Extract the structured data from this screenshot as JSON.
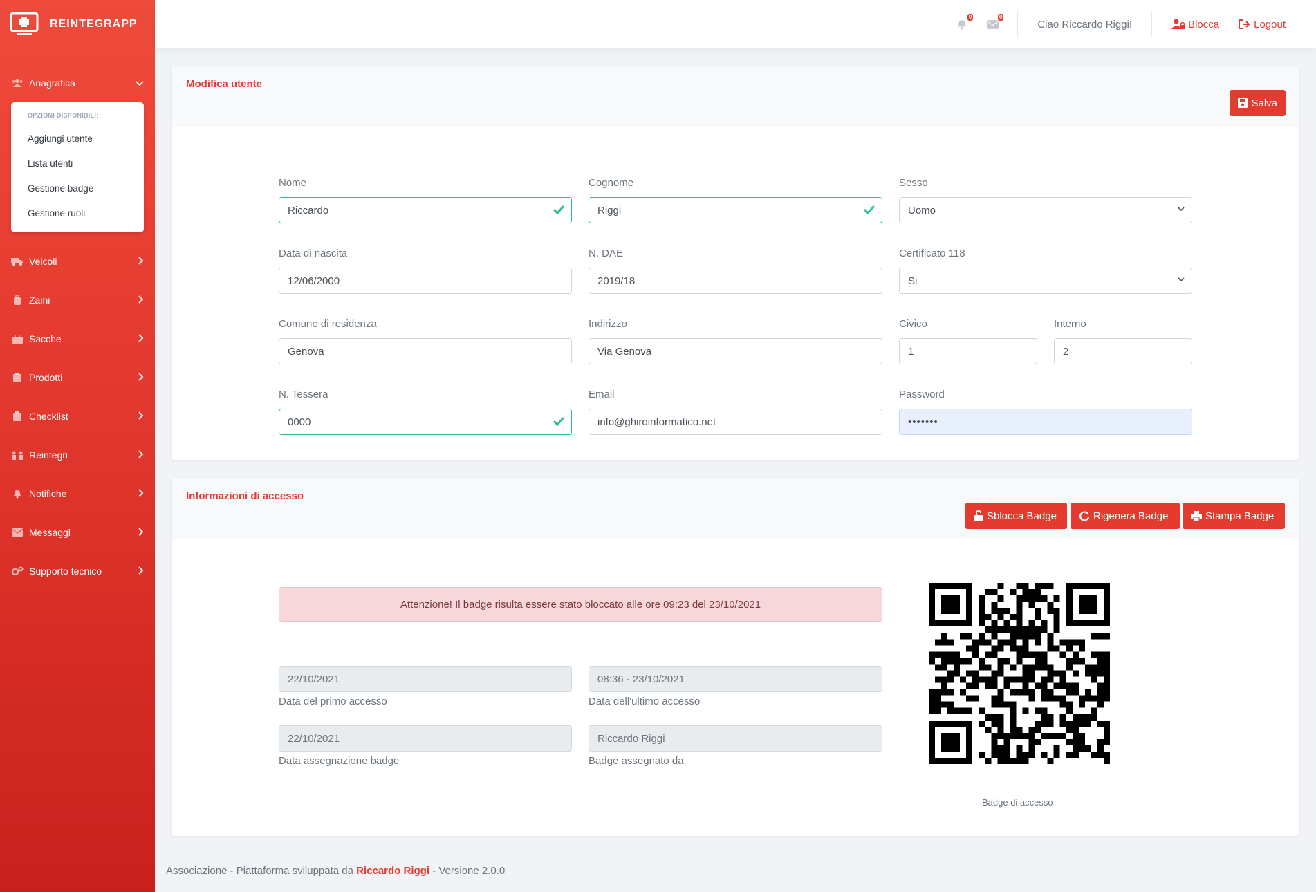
{
  "brand": {
    "name": "REINTEGRAPP"
  },
  "sidebar": {
    "anagrafica": {
      "label": "Anagrafica"
    },
    "submenu": {
      "heading": "OPZIONI DISPONIBILI:",
      "items": [
        "Aggiungi utente",
        "Lista utenti",
        "Gestione badge",
        "Gestione ruoli"
      ]
    },
    "items": [
      {
        "label": "Veicoli",
        "icon": "truck-icon"
      },
      {
        "label": "Zaini",
        "icon": "backpack-icon"
      },
      {
        "label": "Sacche",
        "icon": "briefcase-icon"
      },
      {
        "label": "Prodotti",
        "icon": "clipboard-icon"
      },
      {
        "label": "Checklist",
        "icon": "checklist-icon"
      },
      {
        "label": "Reintegri",
        "icon": "people-icon"
      },
      {
        "label": "Notifiche",
        "icon": "bell-icon"
      },
      {
        "label": "Messaggi",
        "icon": "envelope-icon"
      },
      {
        "label": "Supporto tecnico",
        "icon": "cogs-icon"
      }
    ]
  },
  "topbar": {
    "notifications_count": "0",
    "messages_count": "0",
    "greeting": "Ciao Riccardo Riggi!",
    "lock_label": "Blocca",
    "logout_label": "Logout"
  },
  "edit_card": {
    "title": "Modifica utente",
    "save_label": "Salva",
    "fields": {
      "nome": {
        "label": "Nome",
        "value": "Riccardo"
      },
      "cognome": {
        "label": "Cognome",
        "value": "Riggi"
      },
      "sesso": {
        "label": "Sesso",
        "value": "Uomo"
      },
      "data_nascita": {
        "label": "Data di nascita",
        "value": "12/06/2000"
      },
      "n_dae": {
        "label": "N. DAE",
        "value": "2019/18"
      },
      "certificato": {
        "label": "Certificato 118",
        "value": "Si"
      },
      "comune": {
        "label": "Comune di residenza",
        "value": "Genova"
      },
      "indirizzo": {
        "label": "Indirizzo",
        "value": "Via Genova"
      },
      "civico": {
        "label": "Civico",
        "value": "1"
      },
      "interno": {
        "label": "Interno",
        "value": "2"
      },
      "tessera": {
        "label": "N. Tessera",
        "value": "0000"
      },
      "email": {
        "label": "Email",
        "value": "info@ghiroinformatico.net"
      },
      "password": {
        "label": "Password",
        "value": "•••••••"
      }
    }
  },
  "access_card": {
    "title": "Informazioni di accesso",
    "unlock_label": "Sblocca Badge",
    "regen_label": "Rigenera Badge",
    "print_label": "Stampa Badge",
    "alert": "Attenzione! Il badge risulta essere stato bloccato alle ore 09:23 del 23/10/2021",
    "first_access": {
      "value": "22/10/2021",
      "label": "Data del primo accesso"
    },
    "last_access": {
      "value": "08:36 - 23/10/2021",
      "label": "Data dell'ultimo accesso"
    },
    "badge_assigned_date": {
      "value": "22/10/2021",
      "label": "Data assegnazione badge"
    },
    "badge_assigned_by": {
      "value": "Riccardo Riggi",
      "label": "Badge assegnato da"
    },
    "qr_caption": "Badge di accesso"
  },
  "footer": {
    "prefix": "Associazione - Piattaforma sviluppata da",
    "author": "Riccardo Riggi",
    "suffix": "- Versione 2.0.0"
  },
  "colors": {
    "accent": "#e53a2f",
    "valid": "#28c18a",
    "alert_bg": "#f8d7da"
  }
}
